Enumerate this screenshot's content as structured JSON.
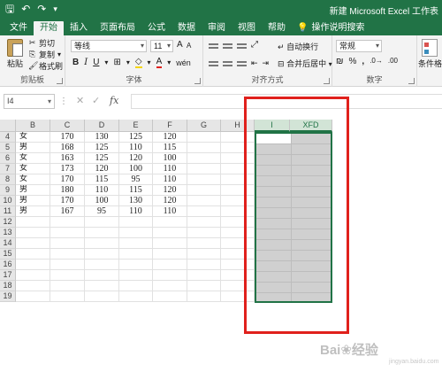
{
  "window": {
    "title": "新建 Microsoft Excel 工作表"
  },
  "qat": {
    "save_icon": "save-icon",
    "undo_icon": "undo-icon",
    "redo_icon": "redo-icon"
  },
  "tabs": [
    "文件",
    "开始",
    "插入",
    "页面布局",
    "公式",
    "数据",
    "审阅",
    "视图",
    "帮助"
  ],
  "active_tab": "开始",
  "tell_me": "操作说明搜索",
  "ribbon": {
    "clipboard": {
      "paste": "粘贴",
      "cut": "剪切",
      "copy": "复制",
      "format_painter": "格式刷",
      "label": "剪贴板"
    },
    "font": {
      "name": "等线",
      "size": "11",
      "grow": "A",
      "shrink": "A",
      "label": "字体",
      "font_color": "#e0201c"
    },
    "alignment": {
      "wrap": "自动换行",
      "merge": "合并后居中",
      "label": "对齐方式"
    },
    "number": {
      "format": "常规",
      "label": "数字"
    },
    "styles": {
      "conditional": "条件格式"
    }
  },
  "formula_bar": {
    "name_box": "I4",
    "cancel": "✕",
    "enter": "✓",
    "fx": "fx",
    "value": ""
  },
  "columns": [
    "B",
    "C",
    "D",
    "E",
    "F",
    "G",
    "H",
    "I",
    "XFD"
  ],
  "selected_columns": [
    "I",
    "XFD"
  ],
  "rows": [
    {
      "num": "4",
      "cells": [
        "女",
        "170",
        "130",
        "125",
        "120"
      ]
    },
    {
      "num": "5",
      "cells": [
        "男",
        "168",
        "125",
        "110",
        "115"
      ]
    },
    {
      "num": "6",
      "cells": [
        "女",
        "163",
        "125",
        "120",
        "100"
      ]
    },
    {
      "num": "7",
      "cells": [
        "女",
        "173",
        "120",
        "100",
        "110"
      ]
    },
    {
      "num": "8",
      "cells": [
        "女",
        "170",
        "115",
        "95",
        "110"
      ]
    },
    {
      "num": "9",
      "cells": [
        "男",
        "180",
        "110",
        "115",
        "120"
      ]
    },
    {
      "num": "10",
      "cells": [
        "男",
        "170",
        "100",
        "130",
        "120"
      ]
    },
    {
      "num": "11",
      "cells": [
        "男",
        "167",
        "95",
        "110",
        "110"
      ]
    },
    {
      "num": "12",
      "cells": []
    },
    {
      "num": "13",
      "cells": []
    },
    {
      "num": "14",
      "cells": []
    },
    {
      "num": "15",
      "cells": []
    },
    {
      "num": "16",
      "cells": []
    },
    {
      "num": "17",
      "cells": []
    },
    {
      "num": "18",
      "cells": []
    },
    {
      "num": "19",
      "cells": []
    }
  ],
  "colors": {
    "accent": "#217346",
    "highlight_box": "#e0201c",
    "selection_fill": "#d0d0d0"
  },
  "watermark": {
    "text": "Bai❀经验",
    "sub": "jingyan.baidu.com"
  }
}
